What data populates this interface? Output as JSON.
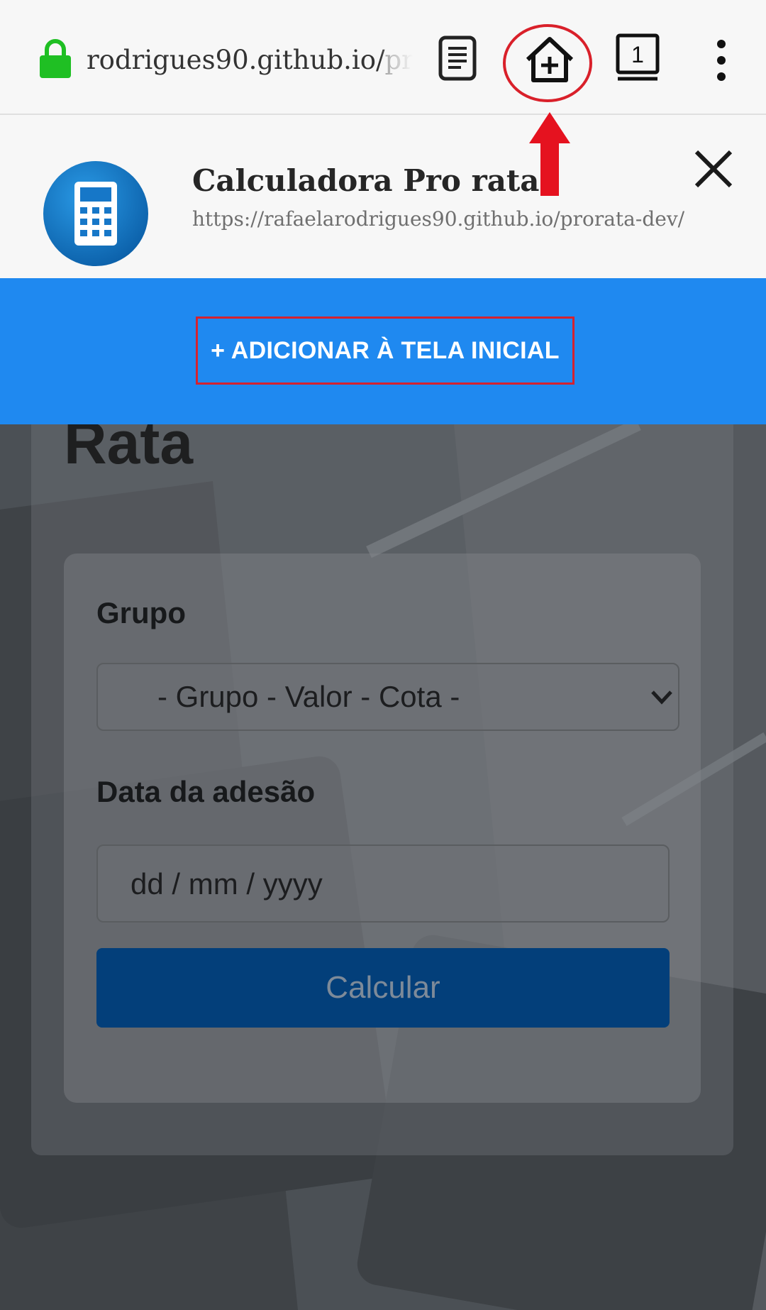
{
  "browser": {
    "url_visible": "rodrigues90.github.io/",
    "url_faded": "pro",
    "tab_count": "1",
    "icons": {
      "lock": "lock-icon",
      "reader": "reader-mode-icon",
      "add_home": "add-to-home-icon",
      "tabs": "tabs-icon",
      "menu": "more-vert-icon"
    }
  },
  "install_banner": {
    "app_title": "Calculadora Pro rata",
    "app_url": "https://rafaelarodrigues90.github.io/prorata-dev/",
    "app_icon": "calculator-icon",
    "close_icon": "close-icon"
  },
  "add_bar": {
    "button_label": "+ ADICIONAR À TELA INICIAL"
  },
  "page": {
    "heading_fragment": "Rata",
    "grupo_label": "Grupo",
    "grupo_select_value": "- Grupo - Valor - Cota -",
    "date_label": "Data da adesão",
    "date_placeholder": "dd / mm / yyyy",
    "calculate_button": "Calcular"
  },
  "colors": {
    "accent_blue": "#1f89f0",
    "annotation_red": "#d9202a",
    "lock_green": "#1fbf23",
    "calc_button": "#033f7a"
  }
}
